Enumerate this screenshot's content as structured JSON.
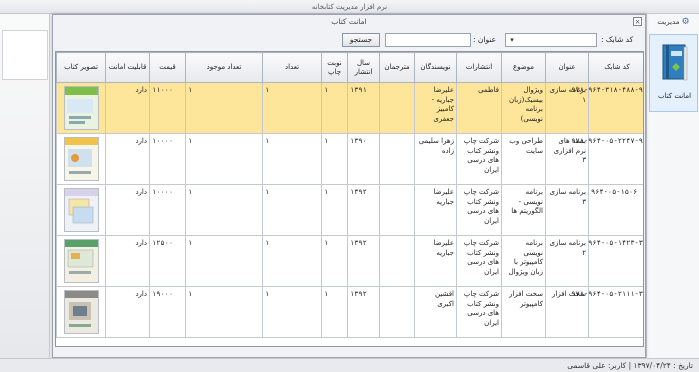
{
  "app": {
    "title": "نرم افزار مدیریت کتابخانه"
  },
  "ribbon": {
    "header": "مدیریت",
    "book_button_label": "امانت کتاب"
  },
  "dialog": {
    "title": "امانت کتاب",
    "close_label": "×",
    "search": {
      "isbn_label": "کد شابک :",
      "title_label": "عنوان :",
      "title_value": "",
      "button_label": "جستجو"
    }
  },
  "table": {
    "headers": [
      "کد شابک",
      "عنوان",
      "موضوع",
      "انتشارات",
      "نویسندگان",
      "مترجمان",
      "سال انتشار",
      "نوبت چاپ",
      "تعداد",
      "تعداد موجود",
      "قیمت",
      "قابلیت امانت",
      "تصویر کتاب"
    ],
    "rows": [
      {
        "isbn": "۹۷۸-۹۶۴-۳۱۸-۴۸۸-۹",
        "title": "برنامه سازی ۱",
        "subject": "ویژوال بیسیک(زبان برنامه نویسی)",
        "publisher": "فاطمی",
        "authors": "علیرضا جباریه - کامبیز جعفری",
        "translators": "",
        "year": "۱۳۹۱",
        "edition": "۱",
        "count": "۱",
        "available": "۱",
        "price": "۱۱۰۰۰",
        "lendable": "دارد"
      },
      {
        "isbn": "۹۷۸-۹۶۴-۰۵-۲۲۴۷-۹",
        "title": "بسته های نرم افزاری ۳",
        "subject": "طراحی وب سایت",
        "publisher": "شرکت چاپ ونشر کتاب های درسی ایران",
        "authors": "زهرا سلیمی زاده",
        "translators": "",
        "year": "۱۳۹۰",
        "edition": "۱",
        "count": "۱",
        "available": "۱",
        "price": "۱۰۰۰۰",
        "lendable": "دارد"
      },
      {
        "isbn": "۹۶۴-۰۵-۱۵۰۶",
        "title": "برنامه سازی ۳",
        "subject": "برنامه نویسی - الگوریتم ها",
        "publisher": "شرکت چاپ ونشر کتاب های درسی ایران",
        "authors": "علیرضا جباریه",
        "translators": "",
        "year": "۱۳۹۲",
        "edition": "۱",
        "count": "۱",
        "available": "۱",
        "price": "۱۰۰۰۰",
        "lendable": "دارد"
      },
      {
        "isbn": "۹۶۴-۰۵-۱۴۲۳-۳",
        "title": "برنامه سازی ۲",
        "subject": "برنامه نویسی کامپیوتر با زبان ویژوال",
        "publisher": "شرکت چاپ ونشر کتاب های درسی ایران",
        "authors": "علیرضا جباریه",
        "translators": "",
        "year": "۱۳۹۲",
        "edition": "۱",
        "count": "۱",
        "available": "۱",
        "price": "۱۲۵۰۰",
        "lendable": "دارد"
      },
      {
        "isbn": "۹۷۸-۹۶۴-۰۵-۲۱۱۱-۳",
        "title": "سخت افزار",
        "subject": "سخت افزار کامپیوتر",
        "publisher": "شرکت چاپ ونشر کتاب های درسی ایران",
        "authors": "افشین اکبری",
        "translators": "",
        "year": "۱۳۹۲",
        "edition": "۱",
        "count": "۱",
        "available": "۱",
        "price": "۱۹۰۰۰",
        "lendable": "دارد"
      }
    ]
  },
  "status": {
    "text": "تاریخ : ۱۳۹۷/۰۴/۲۴ | کاربر: علی قاسمی"
  },
  "colors": {
    "selected_row": "#fde59a",
    "accent": "#3b6fb6"
  }
}
